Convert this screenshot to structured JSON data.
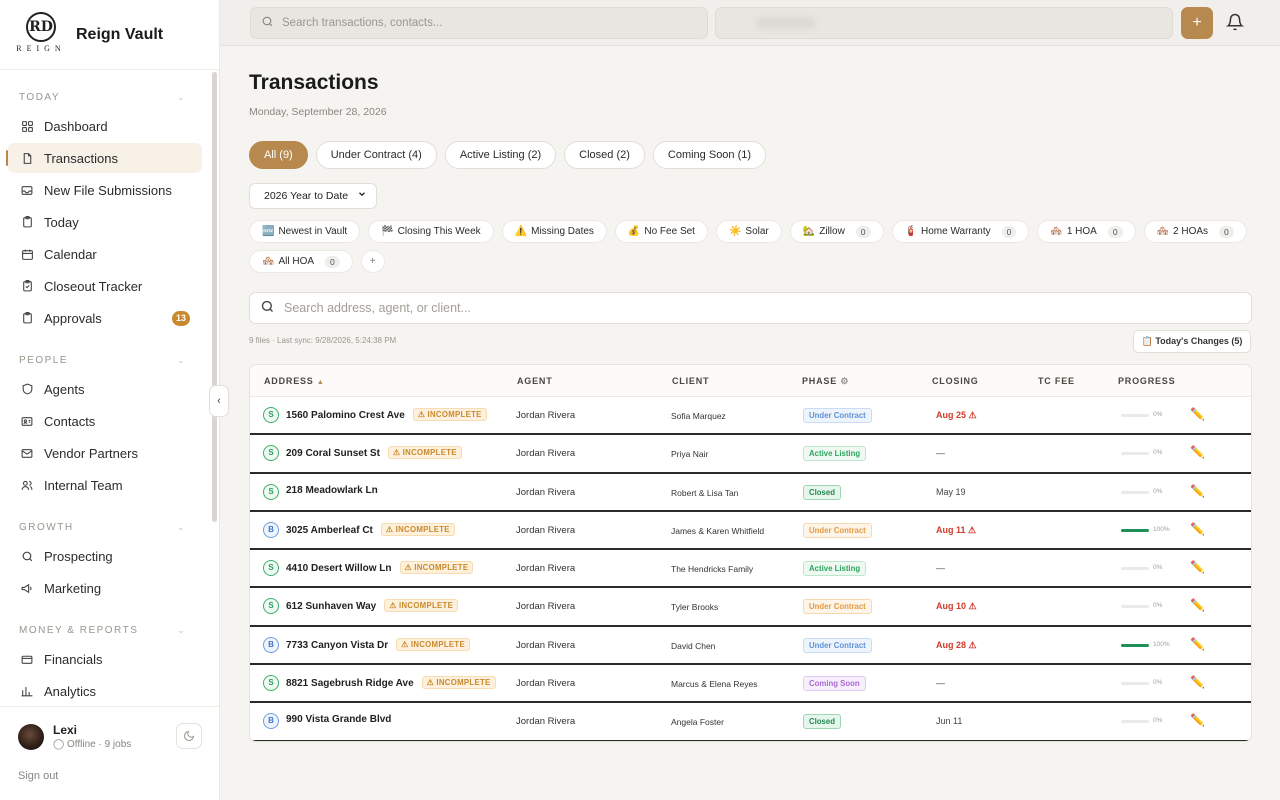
{
  "brand": {
    "logo_mono": "RD",
    "logo_word": "REIGN",
    "name": "Reign Vault"
  },
  "sidebar": {
    "sections": [
      {
        "label": "TODAY",
        "items": [
          {
            "label": "Dashboard",
            "icon": "grid-icon"
          },
          {
            "label": "Transactions",
            "icon": "file-icon",
            "active": true
          },
          {
            "label": "New File Submissions",
            "icon": "inbox-icon"
          },
          {
            "label": "Today",
            "icon": "clipboard-icon"
          },
          {
            "label": "Calendar",
            "icon": "calendar-icon"
          },
          {
            "label": "Closeout Tracker",
            "icon": "clipboard-check-icon"
          },
          {
            "label": "Approvals",
            "icon": "clipboard-icon",
            "badge": "13"
          }
        ]
      },
      {
        "label": "PEOPLE",
        "items": [
          {
            "label": "Agents",
            "icon": "shield-icon"
          },
          {
            "label": "Contacts",
            "icon": "contact-card-icon"
          },
          {
            "label": "Vendor Partners",
            "icon": "mail-icon"
          },
          {
            "label": "Internal Team",
            "icon": "users-icon"
          }
        ]
      },
      {
        "label": "GROWTH",
        "items": [
          {
            "label": "Prospecting",
            "icon": "search-icon"
          },
          {
            "label": "Marketing",
            "icon": "megaphone-icon"
          }
        ]
      },
      {
        "label": "MONEY & REPORTS",
        "items": [
          {
            "label": "Financials",
            "icon": "wallet-icon"
          },
          {
            "label": "Analytics",
            "icon": "bar-chart-icon"
          }
        ]
      }
    ]
  },
  "user": {
    "name": "Lexi",
    "status": "◯ Offline · 9 jobs",
    "signout": "Sign out"
  },
  "topbar": {
    "search_placeholder": "Search transactions, contacts...",
    "add_label": "+"
  },
  "page": {
    "title": "Transactions",
    "date": "Monday, September 28, 2026",
    "tabs": [
      "All (9)",
      "Under Contract (4)",
      "Active Listing (2)",
      "Closed (2)",
      "Coming Soon (1)"
    ],
    "active_tab": 0,
    "year_filter": "2026 Year to Date",
    "filters": [
      {
        "emoji": "🆕",
        "label": "Newest in Vault"
      },
      {
        "emoji": "🏁",
        "label": "Closing This Week"
      },
      {
        "emoji": "⚠️",
        "label": "Missing Dates"
      },
      {
        "emoji": "💰",
        "label": "No Fee Set"
      },
      {
        "emoji": "☀️",
        "label": "Solar"
      },
      {
        "emoji": "🏡",
        "label": "Zillow",
        "count": "0"
      },
      {
        "emoji": "🧯",
        "label": "Home Warranty",
        "count": "0"
      },
      {
        "emoji": "🏘️",
        "label": "1 HOA",
        "count": "0"
      },
      {
        "emoji": "🏘️",
        "label": "2 HOAs",
        "count": "0"
      },
      {
        "emoji": "🏘️",
        "label": "All HOA",
        "count": "0"
      }
    ],
    "filter_add": "+",
    "search_placeholder": "Search address, agent, or client...",
    "sync_text": "9 files · Last sync: 9/28/2026, 5:24:38 PM",
    "today_changes": "📋 Today's Changes (5)"
  },
  "table": {
    "headers": {
      "address": "ADDRESS",
      "agent": "AGENT",
      "client": "CLIENT",
      "phase": "PHASE",
      "closing": "CLOSING",
      "tc_fee": "TC FEE",
      "progress": "PROGRESS"
    },
    "rows": [
      {
        "side": "S",
        "address": "1560 Palomino Crest Ave",
        "incomplete": "⚠ INCOMPLETE",
        "agent": "Jordan Rivera",
        "client": "Sofia Marquez",
        "phase": "Under Contract",
        "phase_style": "uc",
        "closing": "Aug 25 ⚠",
        "closing_style": "red",
        "progress": 0,
        "progress_label": "0%"
      },
      {
        "side": "S",
        "address": "209 Coral Sunset St",
        "incomplete": "⚠ INCOMPLETE",
        "agent": "Jordan Rivera",
        "client": "Priya Nair",
        "phase": "Active Listing",
        "phase_style": "al",
        "closing": "—",
        "closing_style": "grey",
        "progress": 0,
        "progress_label": "0%"
      },
      {
        "side": "S",
        "address": "218 Meadowlark Ln",
        "incomplete": "",
        "agent": "Jordan Rivera",
        "client": "Robert & Lisa Tan",
        "phase": "Closed",
        "phase_style": "cl",
        "closing": "May 19",
        "closing_style": "grey",
        "progress": 0,
        "progress_label": "0%"
      },
      {
        "side": "B",
        "address": "3025 Amberleaf Ct",
        "incomplete": "⚠ INCOMPLETE",
        "agent": "Jordan Rivera",
        "client": "James & Karen Whitfield",
        "phase": "Under Contract",
        "phase_style": "uco",
        "closing": "Aug 11 ⚠",
        "closing_style": "red",
        "progress": 100,
        "progress_label": "100%"
      },
      {
        "side": "S",
        "address": "4410 Desert Willow Ln",
        "incomplete": "⚠ INCOMPLETE",
        "agent": "Jordan Rivera",
        "client": "The Hendricks Family",
        "phase": "Active Listing",
        "phase_style": "al",
        "closing": "—",
        "closing_style": "grey",
        "progress": 0,
        "progress_label": "0%"
      },
      {
        "side": "S",
        "address": "612 Sunhaven Way",
        "incomplete": "⚠ INCOMPLETE",
        "agent": "Jordan Rivera",
        "client": "Tyler Brooks",
        "phase": "Under Contract",
        "phase_style": "uco",
        "closing": "Aug 10 ⚠",
        "closing_style": "red",
        "progress": 0,
        "progress_label": "0%"
      },
      {
        "side": "B",
        "address": "7733 Canyon Vista Dr",
        "incomplete": "⚠ INCOMPLETE",
        "agent": "Jordan Rivera",
        "client": "David Chen",
        "phase": "Under Contract",
        "phase_style": "uc",
        "closing": "Aug 28 ⚠",
        "closing_style": "red",
        "progress": 100,
        "progress_label": "100%"
      },
      {
        "side": "S",
        "address": "8821 Sagebrush Ridge Ave",
        "incomplete": "⚠ INCOMPLETE",
        "agent": "Jordan Rivera",
        "client": "Marcus & Elena Reyes",
        "phase": "Coming Soon",
        "phase_style": "cs",
        "closing": "—",
        "closing_style": "grey",
        "progress": 0,
        "progress_label": "0%"
      },
      {
        "side": "B",
        "address": "990 Vista Grande Blvd",
        "incomplete": "",
        "agent": "Jordan Rivera",
        "client": "Angela Foster",
        "phase": "Closed",
        "phase_style": "cl",
        "closing": "Jun 11",
        "closing_style": "grey",
        "progress": 0,
        "progress_label": "0%"
      }
    ]
  },
  "colors": {
    "accent": "#b8894f",
    "badge": "#c98a2e",
    "danger": "#d33a2c",
    "progress": "#1f8f5a"
  }
}
